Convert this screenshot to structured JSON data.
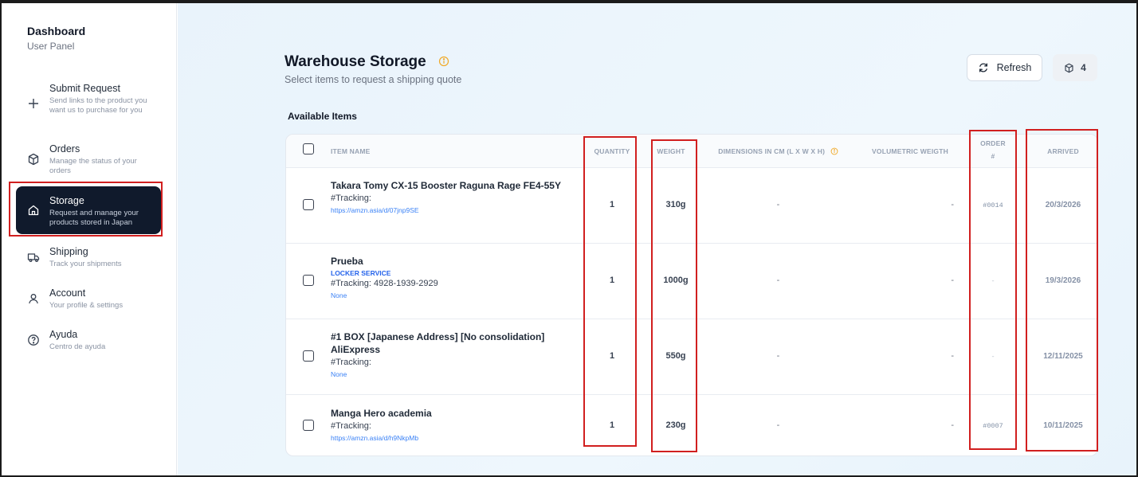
{
  "sidebar": {
    "title": "Dashboard",
    "subtitle": "User Panel",
    "items": [
      {
        "label": "Submit Request",
        "desc": "Send links to the product you want us to purchase for you",
        "icon": "plus-icon"
      },
      {
        "label": "Orders",
        "desc": "Manage the status of your orders",
        "icon": "package-icon"
      },
      {
        "label": "Storage",
        "desc": "Request and manage your products stored in Japan",
        "icon": "home-icon",
        "active": true
      },
      {
        "label": "Shipping",
        "desc": "Track your shipments",
        "icon": "truck-icon"
      },
      {
        "label": "Account",
        "desc": "Your profile & settings",
        "icon": "user-icon"
      },
      {
        "label": "Ayuda",
        "desc": "Centro de ayuda",
        "icon": "help-icon"
      }
    ]
  },
  "header": {
    "title": "Warehouse Storage",
    "subtitle": "Select items to request a shipping quote",
    "refresh_label": "Refresh",
    "count": "4"
  },
  "table": {
    "section_title": "Available Items",
    "columns": {
      "item_name": "ITEM NAME",
      "quantity": "QUANTITY",
      "weight": "WEIGHT",
      "dimensions": "DIMENSIONS IN CM (L X W X H)",
      "volumetric": "VOLUMETRIC WEIGTH",
      "order_line1": "ORDER",
      "order_line2": "#",
      "arrived": "ARRIVED"
    },
    "rows": [
      {
        "name": "Takara Tomy CX-15 Booster Raguna Rage FE4-55Y",
        "tag": "",
        "tracking": "#Tracking:",
        "link": "https://amzn.asia/d/07jnp9SE",
        "quantity": "1",
        "weight": "310g",
        "dimensions": "-",
        "volumetric": "-",
        "order": "#0014",
        "arrived": "20/3/2026"
      },
      {
        "name": "Prueba",
        "tag": "LOCKER SERVICE",
        "tracking": "#Tracking: 4928-1939-2929",
        "link": "None",
        "quantity": "1",
        "weight": "1000g",
        "dimensions": "-",
        "volumetric": "-",
        "order": "-",
        "arrived": "19/3/2026"
      },
      {
        "name": "#1 BOX [Japanese Address] [No consolidation] AliExpress",
        "tag": "",
        "tracking": "#Tracking:",
        "link": "None",
        "quantity": "1",
        "weight": "550g",
        "dimensions": "-",
        "volumetric": "-",
        "order": "-",
        "arrived": "12/11/2025"
      },
      {
        "name": "Manga Hero academia",
        "tag": "",
        "tracking": "#Tracking:",
        "link": "https://amzn.asia/d/h9NkpMb",
        "quantity": "1",
        "weight": "230g",
        "dimensions": "-",
        "volumetric": "-",
        "order": "#0007",
        "arrived": "10/11/2025"
      }
    ]
  },
  "colors": {
    "highlight": "#d11f1f",
    "active_nav": "#101a2c",
    "info": "#f0a928",
    "link": "#3b82f6"
  }
}
